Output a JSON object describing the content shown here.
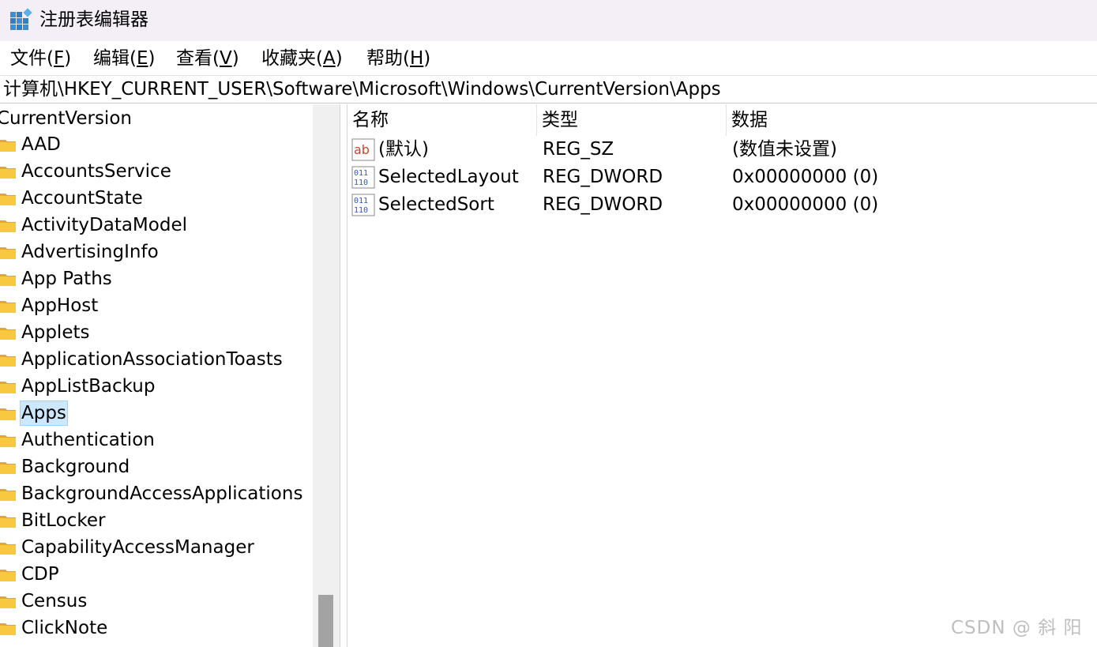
{
  "window": {
    "title": "注册表编辑器",
    "app_icon": "registry-editor-icon"
  },
  "menu": [
    {
      "label": "文件(",
      "key": "F",
      "suffix": ")"
    },
    {
      "label": "编辑(",
      "key": "E",
      "suffix": ")"
    },
    {
      "label": "查看(",
      "key": "V",
      "suffix": ")"
    },
    {
      "label": "收藏夹(",
      "key": "A",
      "suffix": ")"
    },
    {
      "label": "帮助(",
      "key": "H",
      "suffix": ")"
    }
  ],
  "address": "计算机\\HKEY_CURRENT_USER\\Software\\Microsoft\\Windows\\CurrentVersion\\Apps",
  "tree": {
    "parent": "CurrentVersion",
    "items": [
      "AAD",
      "AccountsService",
      "AccountState",
      "ActivityDataModel",
      "AdvertisingInfo",
      "App Paths",
      "AppHost",
      "Applets",
      "ApplicationAssociationToasts",
      "AppListBackup",
      "Apps",
      "Authentication",
      "Background",
      "BackgroundAccessApplications",
      "BitLocker",
      "CapabilityAccessManager",
      "CDP",
      "Census",
      "ClickNote"
    ],
    "selected": "Apps",
    "scroll_position": 0.96
  },
  "list": {
    "columns": [
      "名称",
      "类型",
      "数据"
    ],
    "rows": [
      {
        "icon": "string-value-icon",
        "name": "(默认)",
        "type": "REG_SZ",
        "data": "(数值未设置)"
      },
      {
        "icon": "binary-value-icon",
        "name": "SelectedLayout",
        "type": "REG_DWORD",
        "data": "0x00000000 (0)"
      },
      {
        "icon": "binary-value-icon",
        "name": "SelectedSort",
        "type": "REG_DWORD",
        "data": "0x00000000 (0)"
      }
    ]
  },
  "watermark": "CSDN @ 斜 阳",
  "colors": {
    "titlebar": "#f4eef6",
    "selection": "#cce8ff",
    "folder": "#f8c940",
    "scroll_thumb": "#a3a3a3"
  }
}
